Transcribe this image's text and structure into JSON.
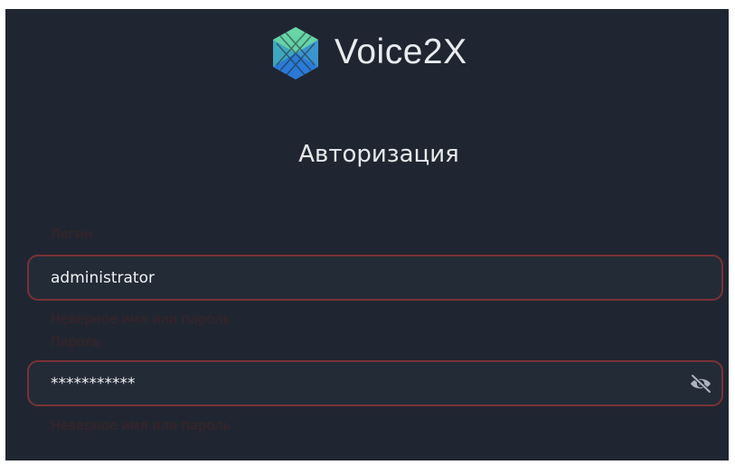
{
  "brand": {
    "name": "Voice2X",
    "logo_icon": "voice2x-hexagon-logo-icon"
  },
  "form": {
    "title": "Авторизация",
    "login": {
      "label": "Логин",
      "value": "administrator",
      "error": "Неверное имя или пароль"
    },
    "password": {
      "label": "Пароль",
      "value": "***********",
      "error": "Неверное имя или пароль",
      "toggle_icon": "eye-slash-icon"
    }
  },
  "colors": {
    "background": "#202631",
    "field_border_error": "#7a3235",
    "error_text": "#3c2328",
    "logo_green": "#5bc59a",
    "logo_blue": "#2f8fd6"
  }
}
